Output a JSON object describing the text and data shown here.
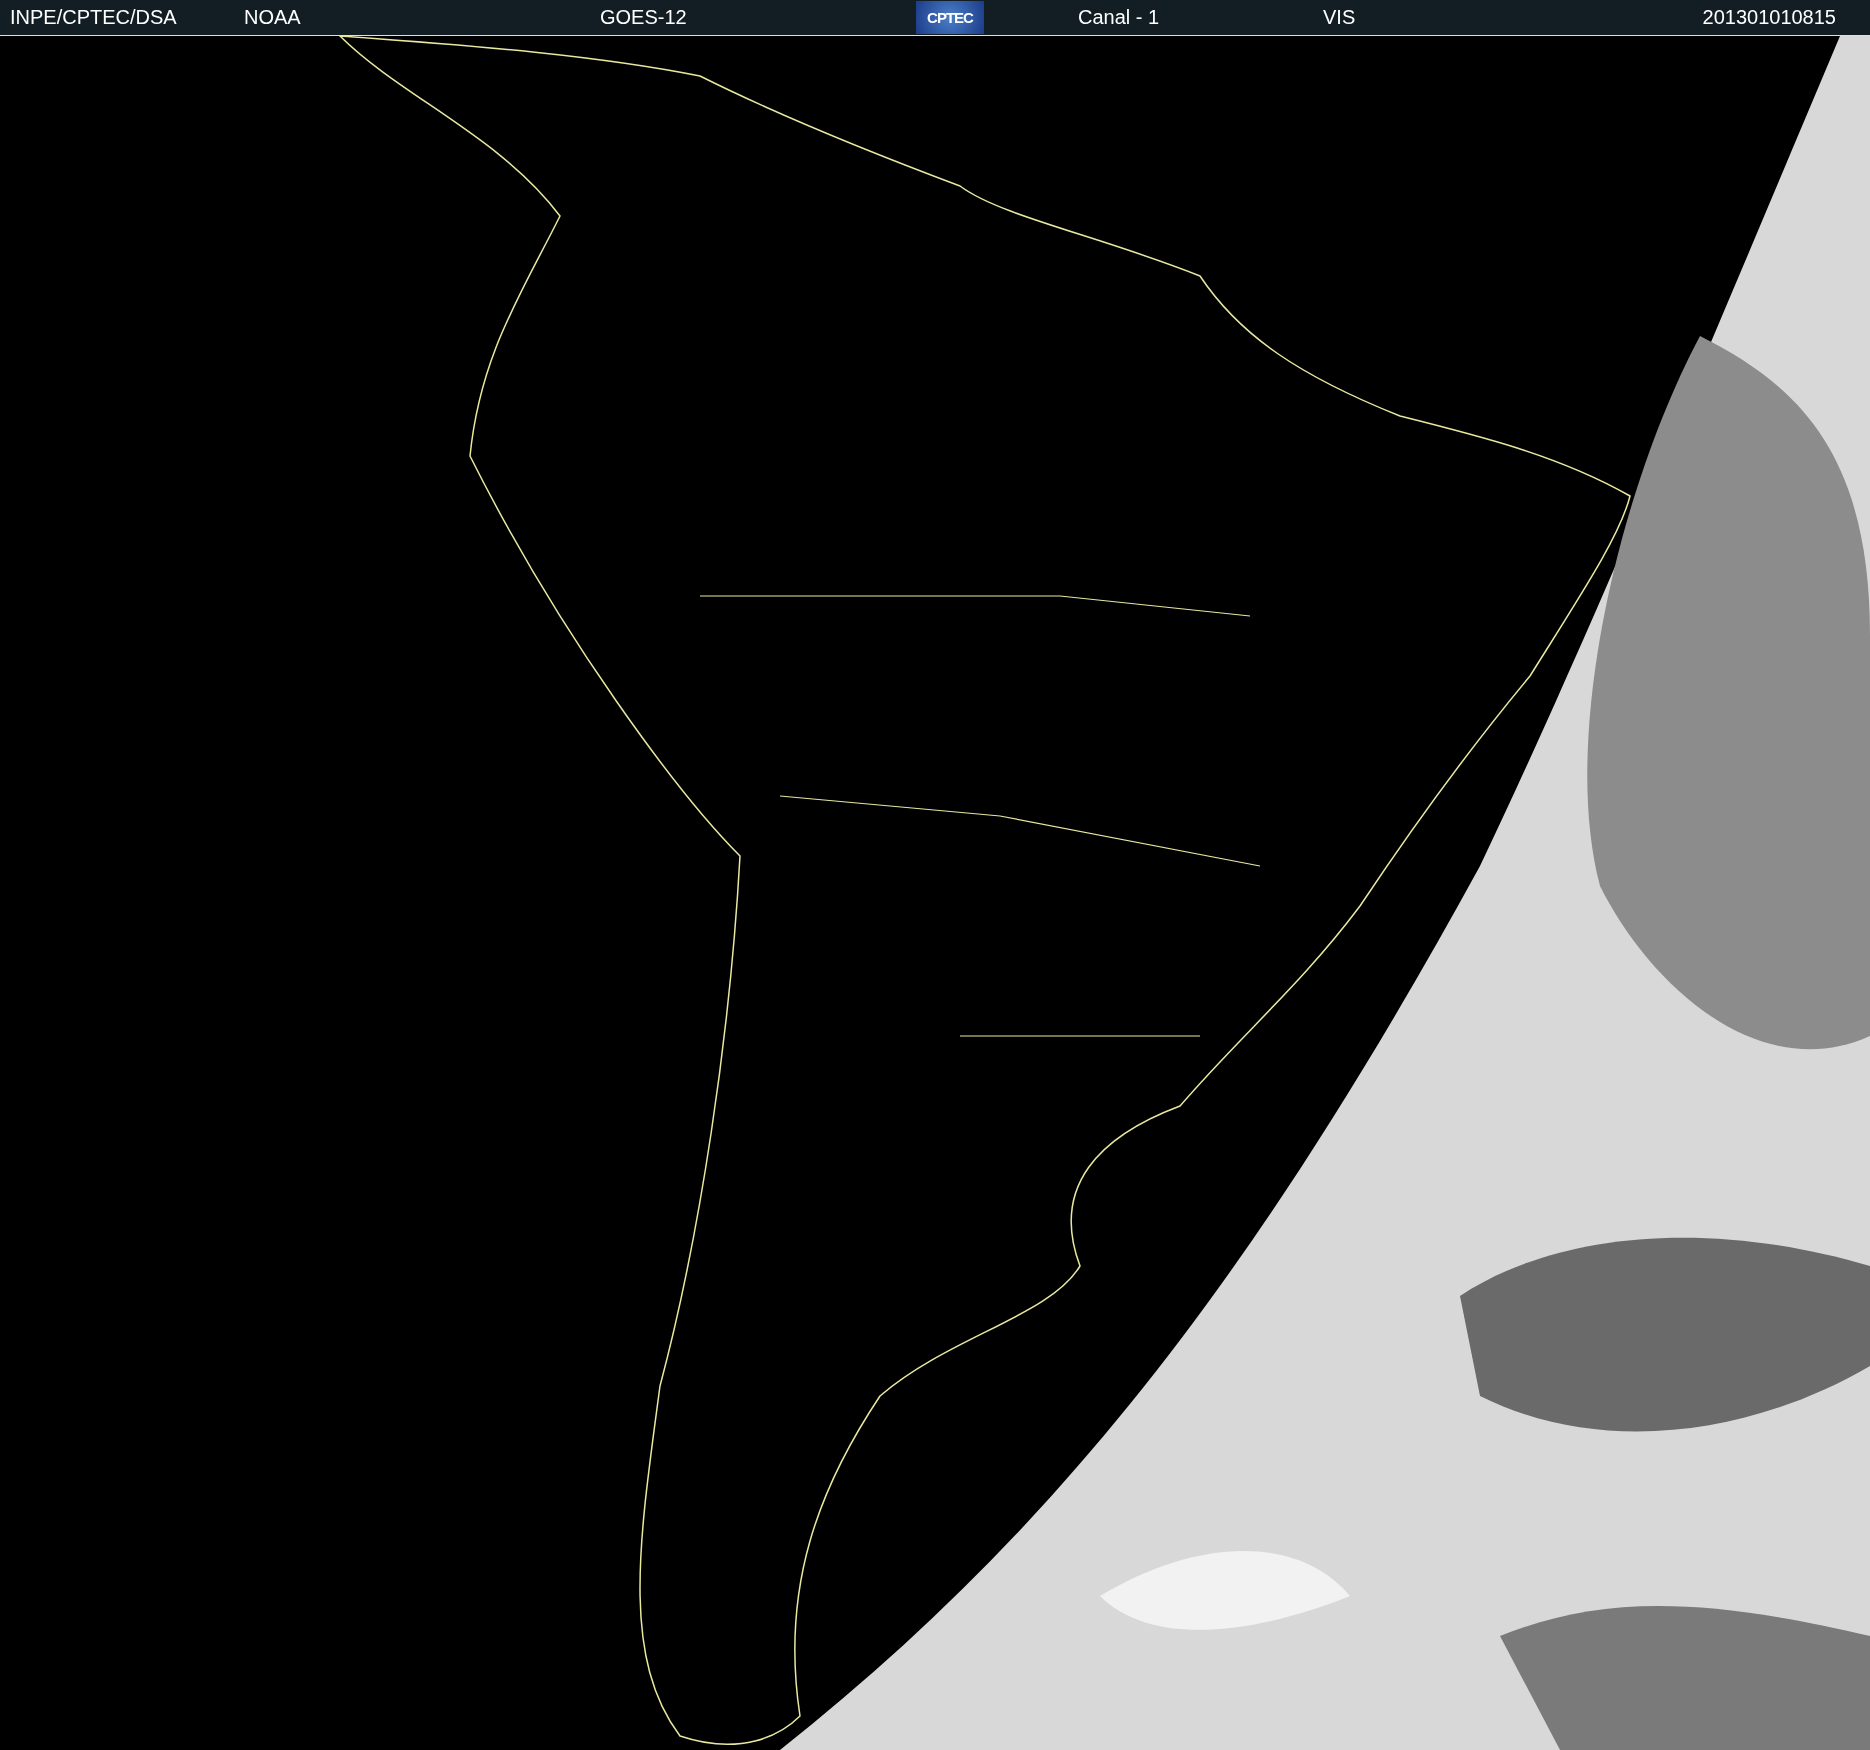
{
  "header": {
    "source": "INPE/CPTEC/DSA",
    "agency": "NOAA",
    "satellite": "GOES-12",
    "logo_text": "CPTEC",
    "channel": "Canal - 1",
    "band": "VIS",
    "timestamp": "201301010815"
  }
}
